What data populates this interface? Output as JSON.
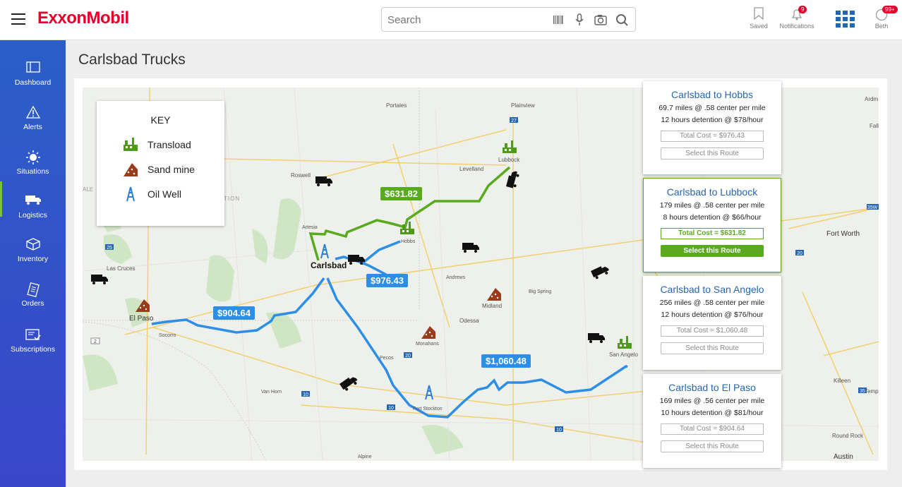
{
  "header": {
    "brand": "ExxonMobil",
    "search_placeholder": "Search",
    "actions": [
      {
        "label": "Saved",
        "icon": "bookmark-icon"
      },
      {
        "label": "Notifications",
        "icon": "bell-icon",
        "badge": "9"
      },
      {
        "label": "",
        "icon": "apps-grid-icon"
      },
      {
        "label": "Beth",
        "icon": "user-icon",
        "badge": "99+"
      }
    ]
  },
  "sidebar": {
    "items": [
      {
        "label": "Dashboard",
        "icon": "dashboard-icon"
      },
      {
        "label": "Alerts",
        "icon": "alert-icon"
      },
      {
        "label": "Situations",
        "icon": "situations-icon"
      },
      {
        "label": "Logistics",
        "icon": "truck-icon"
      },
      {
        "label": "Inventory",
        "icon": "box-icon"
      },
      {
        "label": "Orders",
        "icon": "orders-icon"
      },
      {
        "label": "Subscriptions",
        "icon": "subscriptions-icon"
      }
    ]
  },
  "page": {
    "title": "Carlsbad Trucks"
  },
  "key": {
    "title": "KEY",
    "items": [
      {
        "label": "Transload",
        "icon": "transload-icon",
        "color": "#4f9a1a"
      },
      {
        "label": "Sand mine",
        "icon": "sand-mine-icon",
        "color": "#9b3b1c"
      },
      {
        "label": "Oil Well",
        "icon": "oil-well-icon",
        "color": "#2a7fd6"
      }
    ]
  },
  "map": {
    "cities": [
      "Portales",
      "Plainview",
      "Lubbock",
      "Levelland",
      "Roswell",
      "Artesia",
      "Hobbs",
      "Carlsbad",
      "Las Cruces",
      "El Paso",
      "Socorro",
      "Andrews",
      "Midland",
      "Big Spring",
      "Odessa",
      "Monahans",
      "Pecos",
      "Van Horn",
      "Fort Stockton",
      "San Angelo",
      "Fort Worth",
      "Killeen",
      "Temp",
      "Round Rock",
      "Austin",
      "Ardm",
      "Alpine",
      "Falls"
    ],
    "highways": [
      "27",
      "25",
      "20",
      "10",
      "10",
      "10",
      "35W",
      "20",
      "35",
      "2"
    ],
    "route_prices": [
      {
        "value": "$631.82",
        "color": "#5aaa1e"
      },
      {
        "value": "$976.43",
        "color": "#2d8ee6"
      },
      {
        "value": "$904.64",
        "color": "#2d8ee6"
      },
      {
        "value": "$1,060.48",
        "color": "#2d8ee6"
      }
    ],
    "faded_labels": [
      "ALE",
      "TION"
    ]
  },
  "routes": [
    {
      "title": "Carlsbad to Hobbs",
      "line1": "69.7 miles @ .58 center per mile",
      "line2": "12 hours detention @ $78/hour",
      "total": "Total Cost = $976.43",
      "button": "Select this Route",
      "selected": false
    },
    {
      "title": "Carlsbad to Lubbock",
      "line1": "179 miles @ .58 center per mile",
      "line2": "8 hours detention @ $66/hour",
      "total": "Total Cost = $631.82",
      "button": "Select this Route",
      "selected": true
    },
    {
      "title": "Carlsbad to San Angelo",
      "line1": "256 miles @ .58 center per mile",
      "line2": "12 hours detention @ $76/hour",
      "total": "Total Cost = $1,060.48",
      "button": "Select this Route",
      "selected": false
    },
    {
      "title": "Carlsbad to El Paso",
      "line1": "169 miles @ .56 center per mile",
      "line2": "10 hours detention @ $81/hour",
      "total": "Total Cost = $904.64",
      "button": "Select this Route",
      "selected": false
    }
  ]
}
